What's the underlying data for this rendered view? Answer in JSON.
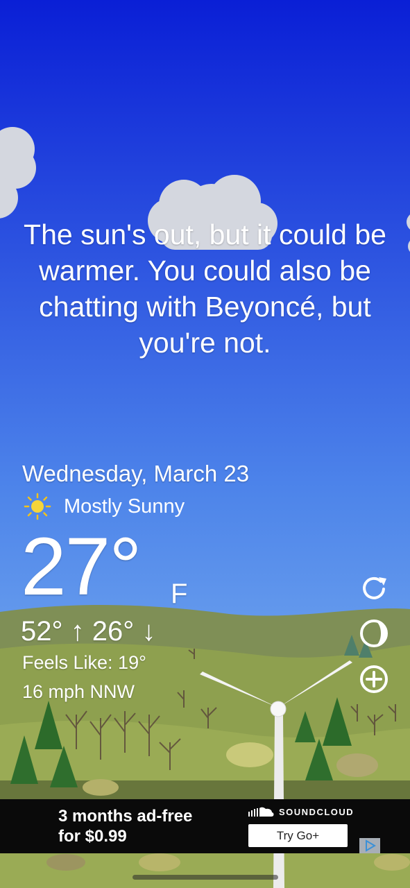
{
  "message": "The sun's out, but it could be warmer. You could also be chatting with Beyoncé, but you're not.",
  "weather": {
    "date": "Wednesday, March 23",
    "condition": "Mostly Sunny",
    "condition_icon": "sun-icon",
    "temperature": "27°",
    "unit": "F",
    "hi_lo": "52° ↑ 26° ↓",
    "feels_like": "Feels Like: 19°",
    "wind": "16 mph NNW"
  },
  "side_buttons": [
    "refresh-icon",
    "theme-toggle-icon",
    "add-location-icon"
  ],
  "ad": {
    "headline_line1": "3 months ad-free",
    "headline_line2": "for $0.99",
    "brand": "SOUNDCLOUD",
    "cta": "Try Go+"
  },
  "colors": {
    "sky_top": "#0a1fd6",
    "sky_bottom": "#7fb2ec",
    "hills": "#8b9b4e",
    "ad_background": "#0a0a0a"
  }
}
